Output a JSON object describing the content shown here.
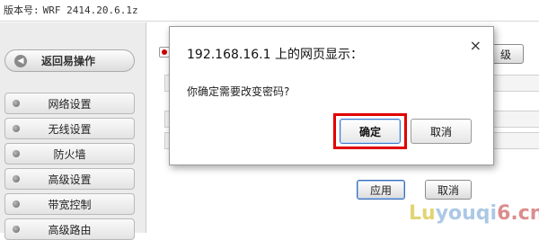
{
  "version_bar": {
    "label": "版本号:",
    "value": "WRF 2414.20.6.1z"
  },
  "sidebar": {
    "back_button": "返回易操作",
    "items": [
      {
        "label": "网络设置"
      },
      {
        "label": "无线设置"
      },
      {
        "label": "防火墙"
      },
      {
        "label": "高级设置"
      },
      {
        "label": "带宽控制"
      },
      {
        "label": "高级路由"
      }
    ]
  },
  "main": {
    "top_button_label": "级",
    "apply_label": "应用",
    "cancel_label": "取消"
  },
  "dialog": {
    "title": "192.168.16.1 上的网页显示：",
    "close_symbol": "×",
    "message": "你确定需要改变密码?",
    "ok_label": "确定",
    "cancel_label": "取消"
  },
  "watermark": {
    "part1": "Lu",
    "part2": "youqi",
    "part3": "6.cn"
  }
}
